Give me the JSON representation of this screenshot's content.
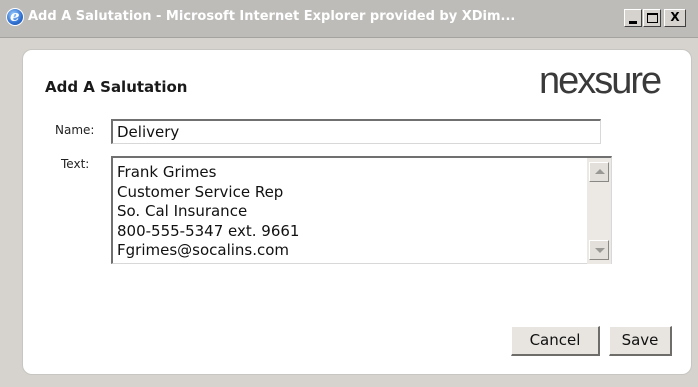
{
  "window": {
    "title": "Add A Salutation - Microsoft Internet Explorer provided by XDim...",
    "controls": {
      "minimize_icon": "minimize-icon",
      "maximize_icon": "maximize-icon",
      "close_label": "X"
    }
  },
  "dialog": {
    "heading": "Add A Salutation",
    "logo_text": "nexsure",
    "name_label": "Name:",
    "name_value": "Delivery",
    "text_label": "Text:",
    "text_lines": [
      "Frank Grimes",
      "Customer Service Rep",
      "So. Cal Insurance",
      "800-555-5347 ext. 9661",
      "Fgrimes@socalins.com"
    ],
    "buttons": {
      "cancel_label": "Cancel",
      "save_label": "Save"
    }
  },
  "colors": {
    "titlebar": "#bdbcb9",
    "window_bg": "#d6d3ce",
    "panel_bg": "#ffffff",
    "logo_accent": "#a4a4a4"
  }
}
